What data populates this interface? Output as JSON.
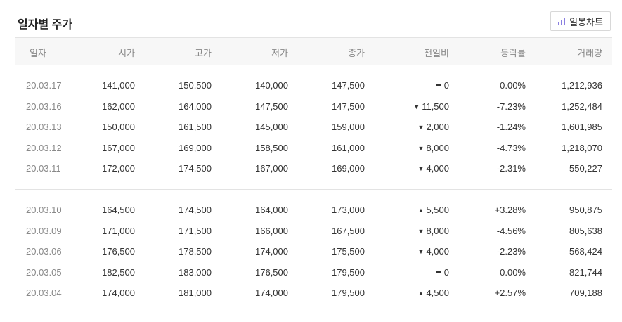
{
  "title": "일자별 주가",
  "chart_button": {
    "label": "일봉차트",
    "icon": "bar-chart-icon"
  },
  "columns": [
    "일자",
    "시가",
    "고가",
    "저가",
    "종가",
    "전일비",
    "등락률",
    "거래량"
  ],
  "colors": {
    "up": "#e62b2b",
    "down": "#2453c7",
    "flat": "#333333"
  },
  "groups": [
    {
      "rows": [
        {
          "date": "20.03.17",
          "open": "141,000",
          "high": "150,500",
          "low": "140,000",
          "close": "147,500",
          "dir": "flat",
          "change": "0",
          "rate": "0.00%",
          "volume": "1,212,936"
        },
        {
          "date": "20.03.16",
          "open": "162,000",
          "high": "164,000",
          "low": "147,500",
          "close": "147,500",
          "dir": "down",
          "change": "11,500",
          "rate": "-7.23%",
          "volume": "1,252,484"
        },
        {
          "date": "20.03.13",
          "open": "150,000",
          "high": "161,500",
          "low": "145,000",
          "close": "159,000",
          "dir": "down",
          "change": "2,000",
          "rate": "-1.24%",
          "volume": "1,601,985"
        },
        {
          "date": "20.03.12",
          "open": "167,000",
          "high": "169,000",
          "low": "158,500",
          "close": "161,000",
          "dir": "down",
          "change": "8,000",
          "rate": "-4.73%",
          "volume": "1,218,070"
        },
        {
          "date": "20.03.11",
          "open": "172,000",
          "high": "174,500",
          "low": "167,000",
          "close": "169,000",
          "dir": "down",
          "change": "4,000",
          "rate": "-2.31%",
          "volume": "550,227"
        }
      ]
    },
    {
      "rows": [
        {
          "date": "20.03.10",
          "open": "164,500",
          "high": "174,500",
          "low": "164,000",
          "close": "173,000",
          "dir": "up",
          "change": "5,500",
          "rate": "+3.28%",
          "volume": "950,875"
        },
        {
          "date": "20.03.09",
          "open": "171,000",
          "high": "171,500",
          "low": "166,000",
          "close": "167,500",
          "dir": "down",
          "change": "8,000",
          "rate": "-4.56%",
          "volume": "805,638"
        },
        {
          "date": "20.03.06",
          "open": "176,500",
          "high": "178,500",
          "low": "174,000",
          "close": "175,500",
          "dir": "down",
          "change": "4,000",
          "rate": "-2.23%",
          "volume": "568,424"
        },
        {
          "date": "20.03.05",
          "open": "182,500",
          "high": "183,000",
          "low": "176,500",
          "close": "179,500",
          "dir": "flat",
          "change": "0",
          "rate": "0.00%",
          "volume": "821,744"
        },
        {
          "date": "20.03.04",
          "open": "174,000",
          "high": "181,000",
          "low": "174,000",
          "close": "179,500",
          "dir": "up",
          "change": "4,500",
          "rate": "+2.57%",
          "volume": "709,188"
        }
      ]
    }
  ]
}
